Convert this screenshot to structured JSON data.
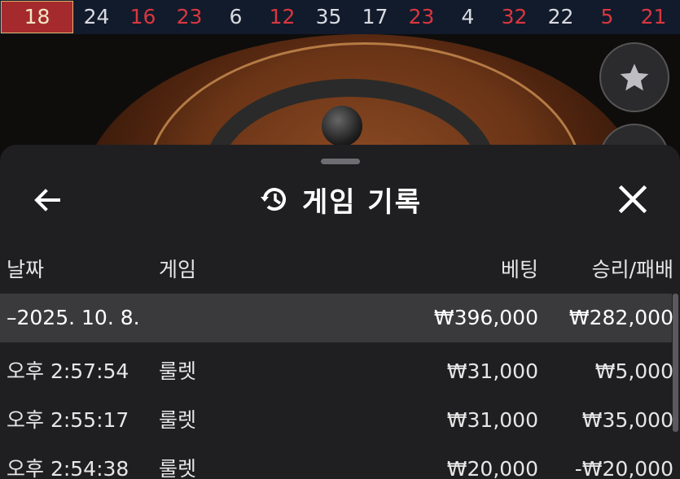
{
  "recent_numbers": [
    {
      "value": "18",
      "color": "red",
      "current": true
    },
    {
      "value": "24",
      "color": "black"
    },
    {
      "value": "16",
      "color": "red"
    },
    {
      "value": "23",
      "color": "red"
    },
    {
      "value": "6",
      "color": "black"
    },
    {
      "value": "12",
      "color": "red"
    },
    {
      "value": "35",
      "color": "black"
    },
    {
      "value": "17",
      "color": "black"
    },
    {
      "value": "23",
      "color": "red"
    },
    {
      "value": "4",
      "color": "black"
    },
    {
      "value": "32",
      "color": "red"
    },
    {
      "value": "22",
      "color": "black"
    },
    {
      "value": "5",
      "color": "red"
    },
    {
      "value": "21",
      "color": "red"
    }
  ],
  "colors": {
    "red": "#d8373f",
    "black": "#d9dbe0",
    "sheet": "#1f1f21",
    "date_row": "#3a3a3d"
  },
  "sheet": {
    "title": "게임 기록",
    "title_icon": "history-icon",
    "back_icon": "arrow-left-icon",
    "close_icon": "close-icon"
  },
  "table": {
    "headers": {
      "date": "날짜",
      "game": "게임",
      "bet": "베팅",
      "result": "승리/패배"
    },
    "date_group": {
      "label": "–2025. 10. 8.",
      "bet": "₩396,000",
      "result": "₩282,000"
    },
    "rows": [
      {
        "time": "오후 2:57:54",
        "game": "룰렛",
        "bet": "₩31,000",
        "result": "₩5,000"
      },
      {
        "time": "오후 2:55:17",
        "game": "룰렛",
        "bet": "₩31,000",
        "result": "₩35,000"
      },
      {
        "time": "오후 2:54:38",
        "game": "룰렛",
        "bet": "₩20,000",
        "result": "-₩20,000"
      }
    ]
  }
}
